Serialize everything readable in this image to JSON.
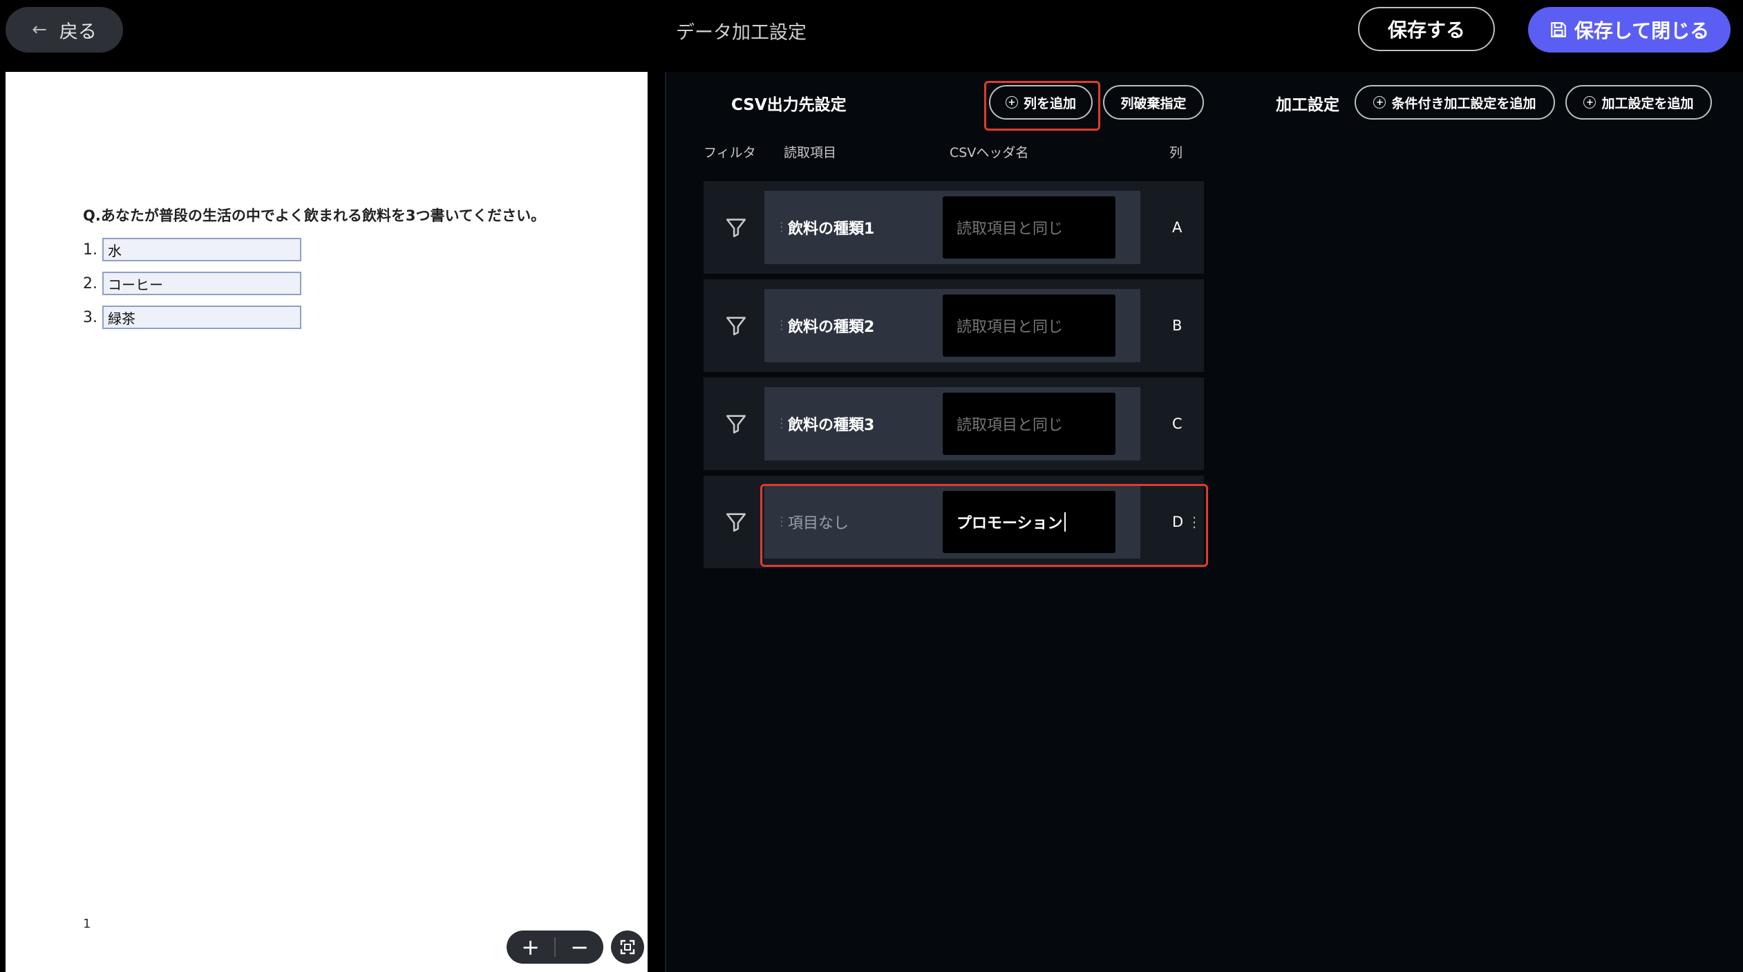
{
  "header": {
    "back_label": "戻る",
    "title": "データ加工設定",
    "save_label": "保存する",
    "save_close_label": "保存して閉じる"
  },
  "document": {
    "question": "Q.あなたが普段の生活の中でよく飲まれる飲料を3つ書いてください。",
    "answers": [
      {
        "num": "1.",
        "value": "水"
      },
      {
        "num": "2.",
        "value": "コーヒー"
      },
      {
        "num": "3.",
        "value": "緑茶"
      }
    ],
    "page_number": "1",
    "zoom_in": "+",
    "zoom_out": "−"
  },
  "csv": {
    "title": "CSV出力先設定",
    "add_column": "列を追加",
    "discard_column": "列破棄指定",
    "columns_header": {
      "filter": "フィルタ",
      "item": "読取項目",
      "header_name": "CSVヘッダ名",
      "column": "列"
    },
    "rows": [
      {
        "item": "飲料の種類1",
        "header": "読取項目と同じ",
        "column": "A"
      },
      {
        "item": "飲料の種類2",
        "header": "読取項目と同じ",
        "column": "B"
      },
      {
        "item": "飲料の種類3",
        "header": "読取項目と同じ",
        "column": "C"
      },
      {
        "item": "項目なし",
        "header": "プロモーション",
        "column": "D"
      }
    ]
  },
  "processing": {
    "title": "加工設定",
    "add_conditional": "条件付き加工設定を追加",
    "add_processing": "加工設定を追加"
  },
  "colors": {
    "accent": "#5b5ef3",
    "highlight": "#e23b2e",
    "panel_bg": "#05090d",
    "row_bg": "#161b22"
  }
}
